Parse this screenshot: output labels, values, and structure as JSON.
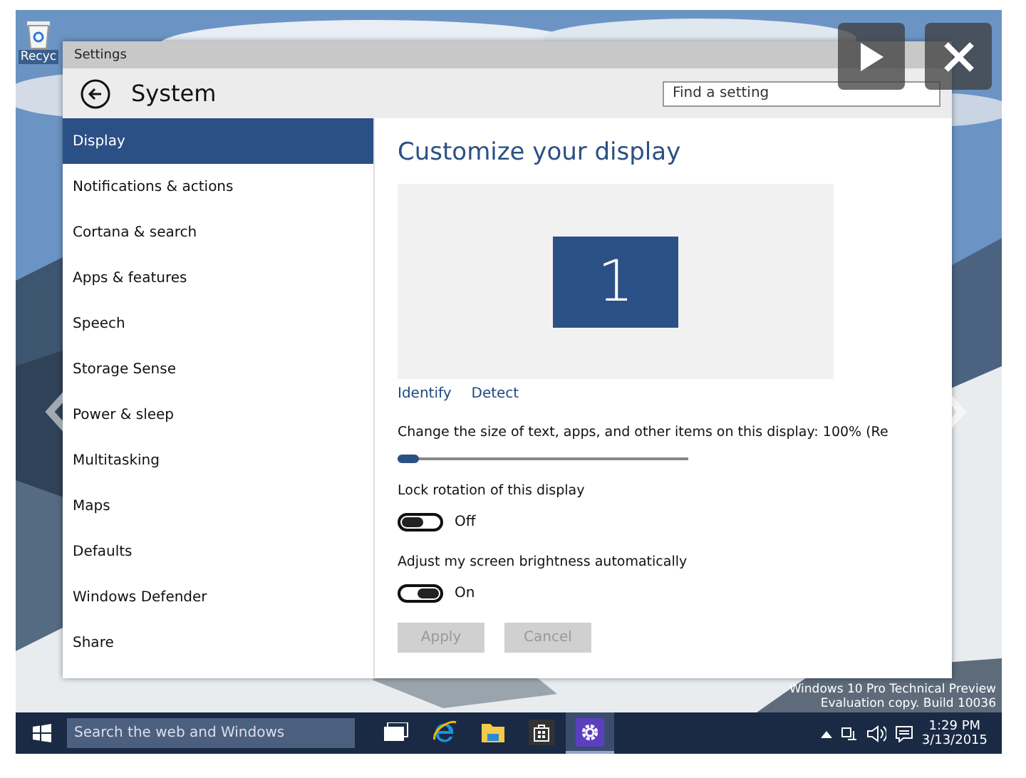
{
  "desktop": {
    "icons": [
      {
        "label": "Recyc"
      }
    ],
    "watermark": [
      "Windows 10 Pro Technical Preview",
      "Evaluation copy. Build 10036"
    ]
  },
  "window": {
    "title": "Settings",
    "heading": "System",
    "search": {
      "placeholder": "Find a setting"
    }
  },
  "sidebar": {
    "items": [
      {
        "label": "Display",
        "selected": true
      },
      {
        "label": "Notifications & actions",
        "selected": false
      },
      {
        "label": "Cortana & search",
        "selected": false
      },
      {
        "label": "Apps & features",
        "selected": false
      },
      {
        "label": "Speech",
        "selected": false
      },
      {
        "label": "Storage Sense",
        "selected": false
      },
      {
        "label": "Power & sleep",
        "selected": false
      },
      {
        "label": "Multitasking",
        "selected": false
      },
      {
        "label": "Maps",
        "selected": false
      },
      {
        "label": "Defaults",
        "selected": false
      },
      {
        "label": "Windows Defender",
        "selected": false
      },
      {
        "label": "Share",
        "selected": false
      }
    ]
  },
  "content": {
    "title": "Customize your display",
    "monitor": "1",
    "links": [
      "Identify",
      "Detect"
    ],
    "scale": {
      "label": "Change the size of text, apps, and other items on this display: 100% (Re",
      "level": 0.0
    },
    "toggles": [
      {
        "label": "Lock rotation of this display",
        "on": false,
        "state": "Off"
      },
      {
        "label": "Adjust my screen brightness automatically",
        "on": true,
        "state": "On"
      }
    ],
    "buttons": [
      {
        "label": "Apply",
        "disabled": true
      },
      {
        "label": "Cancel",
        "disabled": true
      }
    ]
  },
  "taskbar": {
    "search": {
      "placeholder": "Search the web and Windows"
    },
    "apps": [
      {
        "kind": "taskview",
        "selected": false
      },
      {
        "kind": "browser",
        "selected": false
      },
      {
        "kind": "explorer",
        "selected": false
      },
      {
        "kind": "store",
        "selected": false
      },
      {
        "kind": "settings",
        "selected": true
      }
    ],
    "time": "1:29 PM",
    "date": "3/13/2015"
  }
}
